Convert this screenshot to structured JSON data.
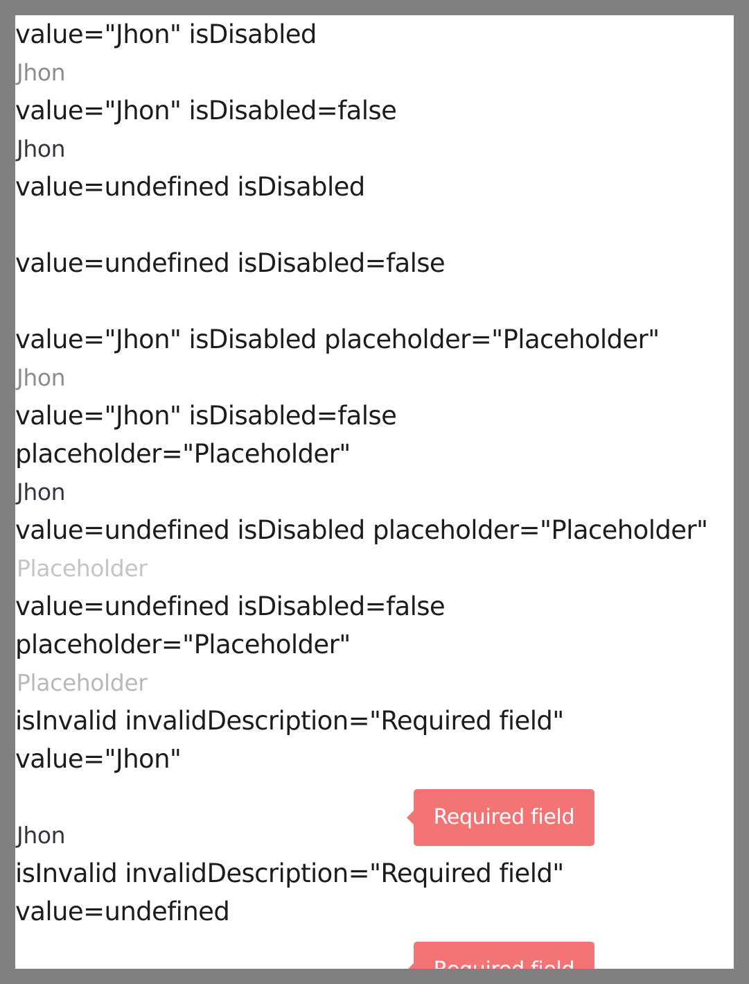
{
  "cases": [
    {
      "label": "value=\"Jhon\" isDisabled",
      "value": "Jhon",
      "placeholder": ""
    },
    {
      "label": "value=\"Jhon\" isDisabled=false",
      "value": "Jhon",
      "placeholder": ""
    },
    {
      "label": "value=undefined isDisabled",
      "value": "",
      "placeholder": ""
    },
    {
      "label": "value=undefined isDisabled=false",
      "value": "",
      "placeholder": ""
    },
    {
      "label": "value=\"Jhon\" isDisabled placeholder=\"Placeholder\"",
      "value": "Jhon",
      "placeholder": "Placeholder"
    },
    {
      "label": "value=\"Jhon\" isDisabled=false\nplaceholder=\"Placeholder\"",
      "value": "Jhon",
      "placeholder": "Placeholder"
    },
    {
      "label": "value=undefined isDisabled placeholder=\"Placeholder\"",
      "value": "",
      "placeholder": "Placeholder"
    },
    {
      "label": "value=undefined isDisabled=false\nplaceholder=\"Placeholder\"",
      "value": "",
      "placeholder": "Placeholder"
    },
    {
      "label": "isInvalid invalidDescription=\"Required field\"\nvalue=\"Jhon\"",
      "value": "Jhon",
      "invalid_description": "Required field"
    },
    {
      "label": "isInvalid invalidDescription=\"Required field\"\nvalue=undefined",
      "value": "",
      "invalid_description": "Required field"
    }
  ],
  "colors": {
    "tooltip_bg": "#f27474",
    "text_enabled": "#33363d",
    "text_disabled": "#8d8d8d",
    "placeholder": "#b8b8b8"
  }
}
